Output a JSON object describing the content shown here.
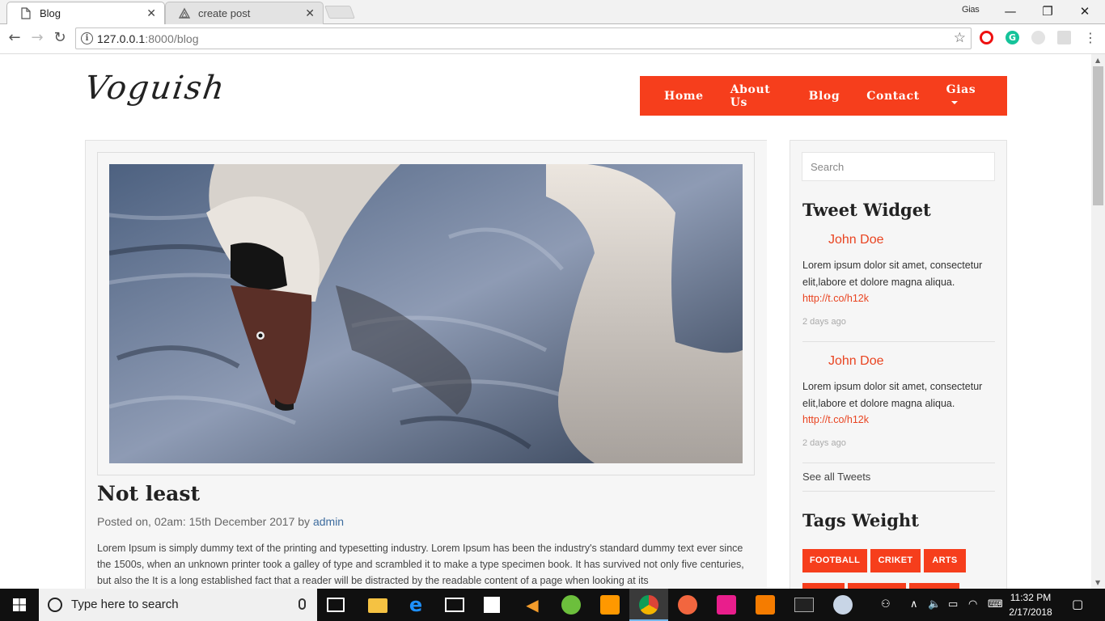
{
  "browser": {
    "tabs": [
      {
        "title": "Blog",
        "active": true
      },
      {
        "title": "create post",
        "active": false
      }
    ],
    "profile_name": "Gias",
    "url": {
      "host": "127.0.0.1",
      "rest": ":8000/blog"
    },
    "window_controls": {
      "minimize": "—",
      "restore": "❐",
      "close": "✕"
    }
  },
  "site": {
    "logo": "Voguish",
    "nav": {
      "home": "Home",
      "about": "About Us",
      "blog": "Blog",
      "contact": "Contact",
      "user": "Gias"
    },
    "post": {
      "title": "Not least",
      "meta_prefix": "Posted on, 02am: 15th December 2017 by ",
      "author": "admin",
      "body": "Lorem Ipsum is simply dummy text of the printing and typesetting industry. Lorem Ipsum has been the industry's standard dummy text ever since the 1500s, when an unknown printer took a galley of type and scrambled it to make a type specimen book. It has survived not only five centuries, but also the It is a long established fact that a reader will be distracted by the readable content of a page when looking at its"
    },
    "sidebar": {
      "search_placeholder": "Search",
      "tweet_title": "Tweet Widget",
      "tweets": [
        {
          "name": "John Doe",
          "text": "Lorem ipsum dolor sit amet, consectetur elit,labore et dolore magna aliqua.",
          "link": "http://t.co/h12k",
          "time": "2 days ago"
        },
        {
          "name": "John Doe",
          "text": "Lorem ipsum dolor sit amet, consectetur elit,labore et dolore magna aliqua.",
          "link": "http://t.co/h12k",
          "time": "2 days ago"
        }
      ],
      "see_all": "See all Tweets",
      "tags_title": "Tags Weight",
      "tags": [
        "FOOTBALL",
        "CRIKET",
        "ARTS"
      ]
    },
    "colors": {
      "accent": "#f63e1c",
      "link": "#e94421",
      "author_link": "#3d6c9e"
    }
  },
  "taskbar": {
    "search_placeholder": "Type here to search",
    "time": "11:32 PM",
    "date": "2/17/2018"
  }
}
